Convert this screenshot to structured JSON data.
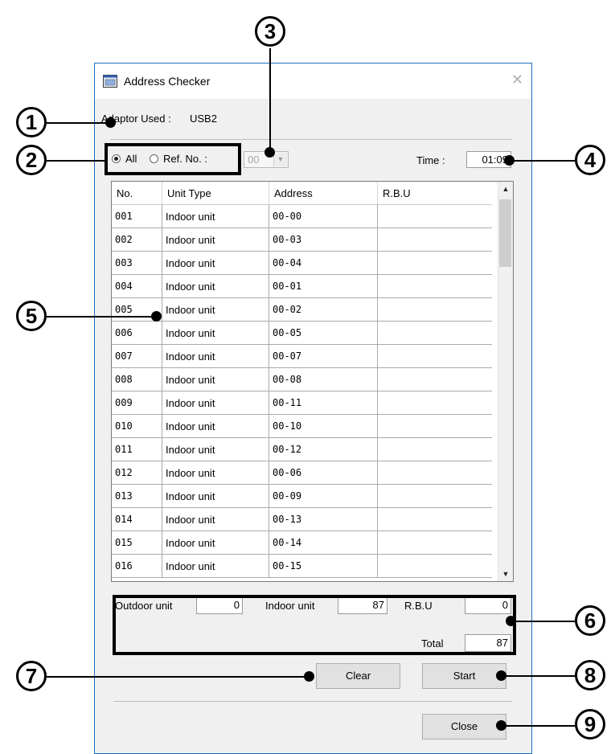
{
  "window": {
    "title": "Address Checker",
    "close_glyph": "✕"
  },
  "adaptor": {
    "label": "Adaptor Used :",
    "value": "USB2"
  },
  "filter": {
    "all_label": "All",
    "ref_label": "Ref. No. :",
    "ref_value": "00",
    "selected": "All"
  },
  "time": {
    "label": "Time :",
    "value": "01:09"
  },
  "table": {
    "columns": [
      "No.",
      "Unit Type",
      "Address",
      "R.B.U"
    ],
    "rows": [
      [
        "001",
        "Indoor unit",
        "00-00",
        ""
      ],
      [
        "002",
        "Indoor unit",
        "00-03",
        ""
      ],
      [
        "003",
        "Indoor unit",
        "00-04",
        ""
      ],
      [
        "004",
        "Indoor unit",
        "00-01",
        ""
      ],
      [
        "005",
        "Indoor unit",
        "00-02",
        ""
      ],
      [
        "006",
        "Indoor unit",
        "00-05",
        ""
      ],
      [
        "007",
        "Indoor unit",
        "00-07",
        ""
      ],
      [
        "008",
        "Indoor unit",
        "00-08",
        ""
      ],
      [
        "009",
        "Indoor unit",
        "00-11",
        ""
      ],
      [
        "010",
        "Indoor unit",
        "00-10",
        ""
      ],
      [
        "011",
        "Indoor unit",
        "00-12",
        ""
      ],
      [
        "012",
        "Indoor unit",
        "00-06",
        ""
      ],
      [
        "013",
        "Indoor unit",
        "00-09",
        ""
      ],
      [
        "014",
        "Indoor unit",
        "00-13",
        ""
      ],
      [
        "015",
        "Indoor unit",
        "00-14",
        ""
      ],
      [
        "016",
        "Indoor unit",
        "00-15",
        ""
      ]
    ]
  },
  "summary": {
    "outdoor_label": "Outdoor unit",
    "outdoor_value": "0",
    "indoor_label": "Indoor unit",
    "indoor_value": "87",
    "rbu_label": "R.B.U",
    "rbu_value": "0",
    "total_label": "Total",
    "total_value": "87"
  },
  "buttons": {
    "clear": "Clear",
    "start": "Start",
    "close": "Close"
  },
  "callouts": [
    "1",
    "2",
    "3",
    "4",
    "5",
    "6",
    "7",
    "8",
    "9"
  ]
}
